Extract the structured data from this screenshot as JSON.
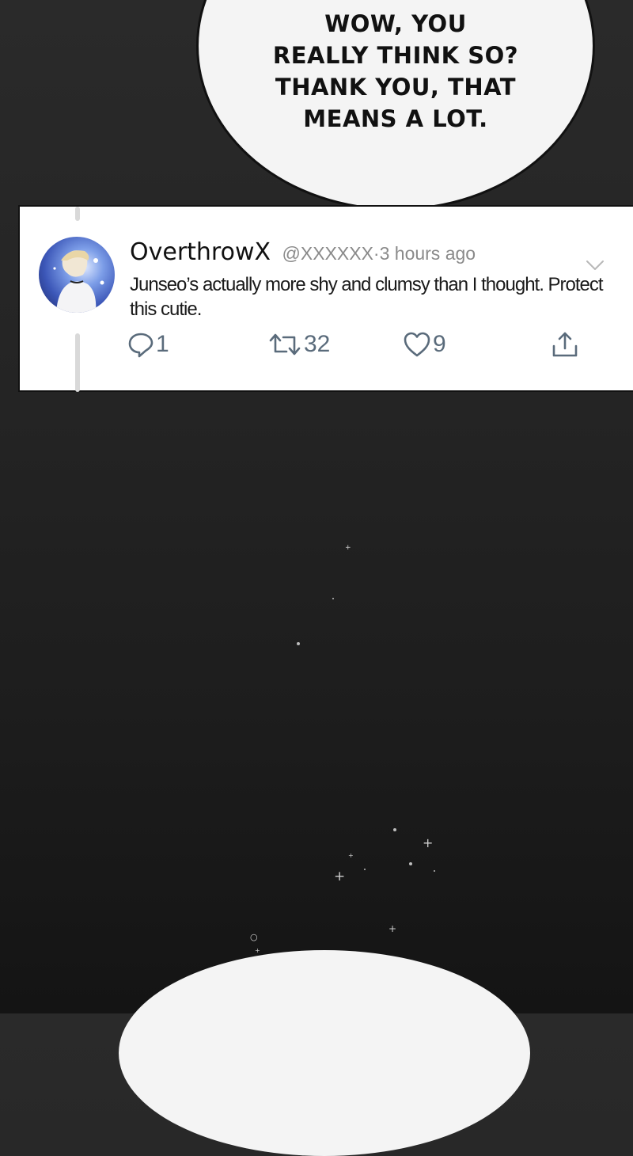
{
  "bubble": {
    "text": "WOW, YOU\nREALLY THINK SO?\nTHANK YOU, THAT\nMEANS A LOT."
  },
  "tweet": {
    "display_name": "OverthrowX",
    "handle": "@XXXXXX",
    "separator": "·",
    "timestamp": "3 hours ago",
    "body": "Junseo’s actually more shy and clumsy than I thought. Protect this cutie.",
    "actions": {
      "reply_count": "1",
      "retweet_count": "32",
      "like_count": "9"
    },
    "icons": {
      "reply": "reply-icon",
      "retweet": "retweet-icon",
      "like": "heart-icon",
      "share": "share-icon",
      "menu": "chevron-down-icon"
    },
    "colors": {
      "action": "#5a6b7b",
      "meta": "#8a8a8a",
      "card": "#ffffff"
    }
  }
}
